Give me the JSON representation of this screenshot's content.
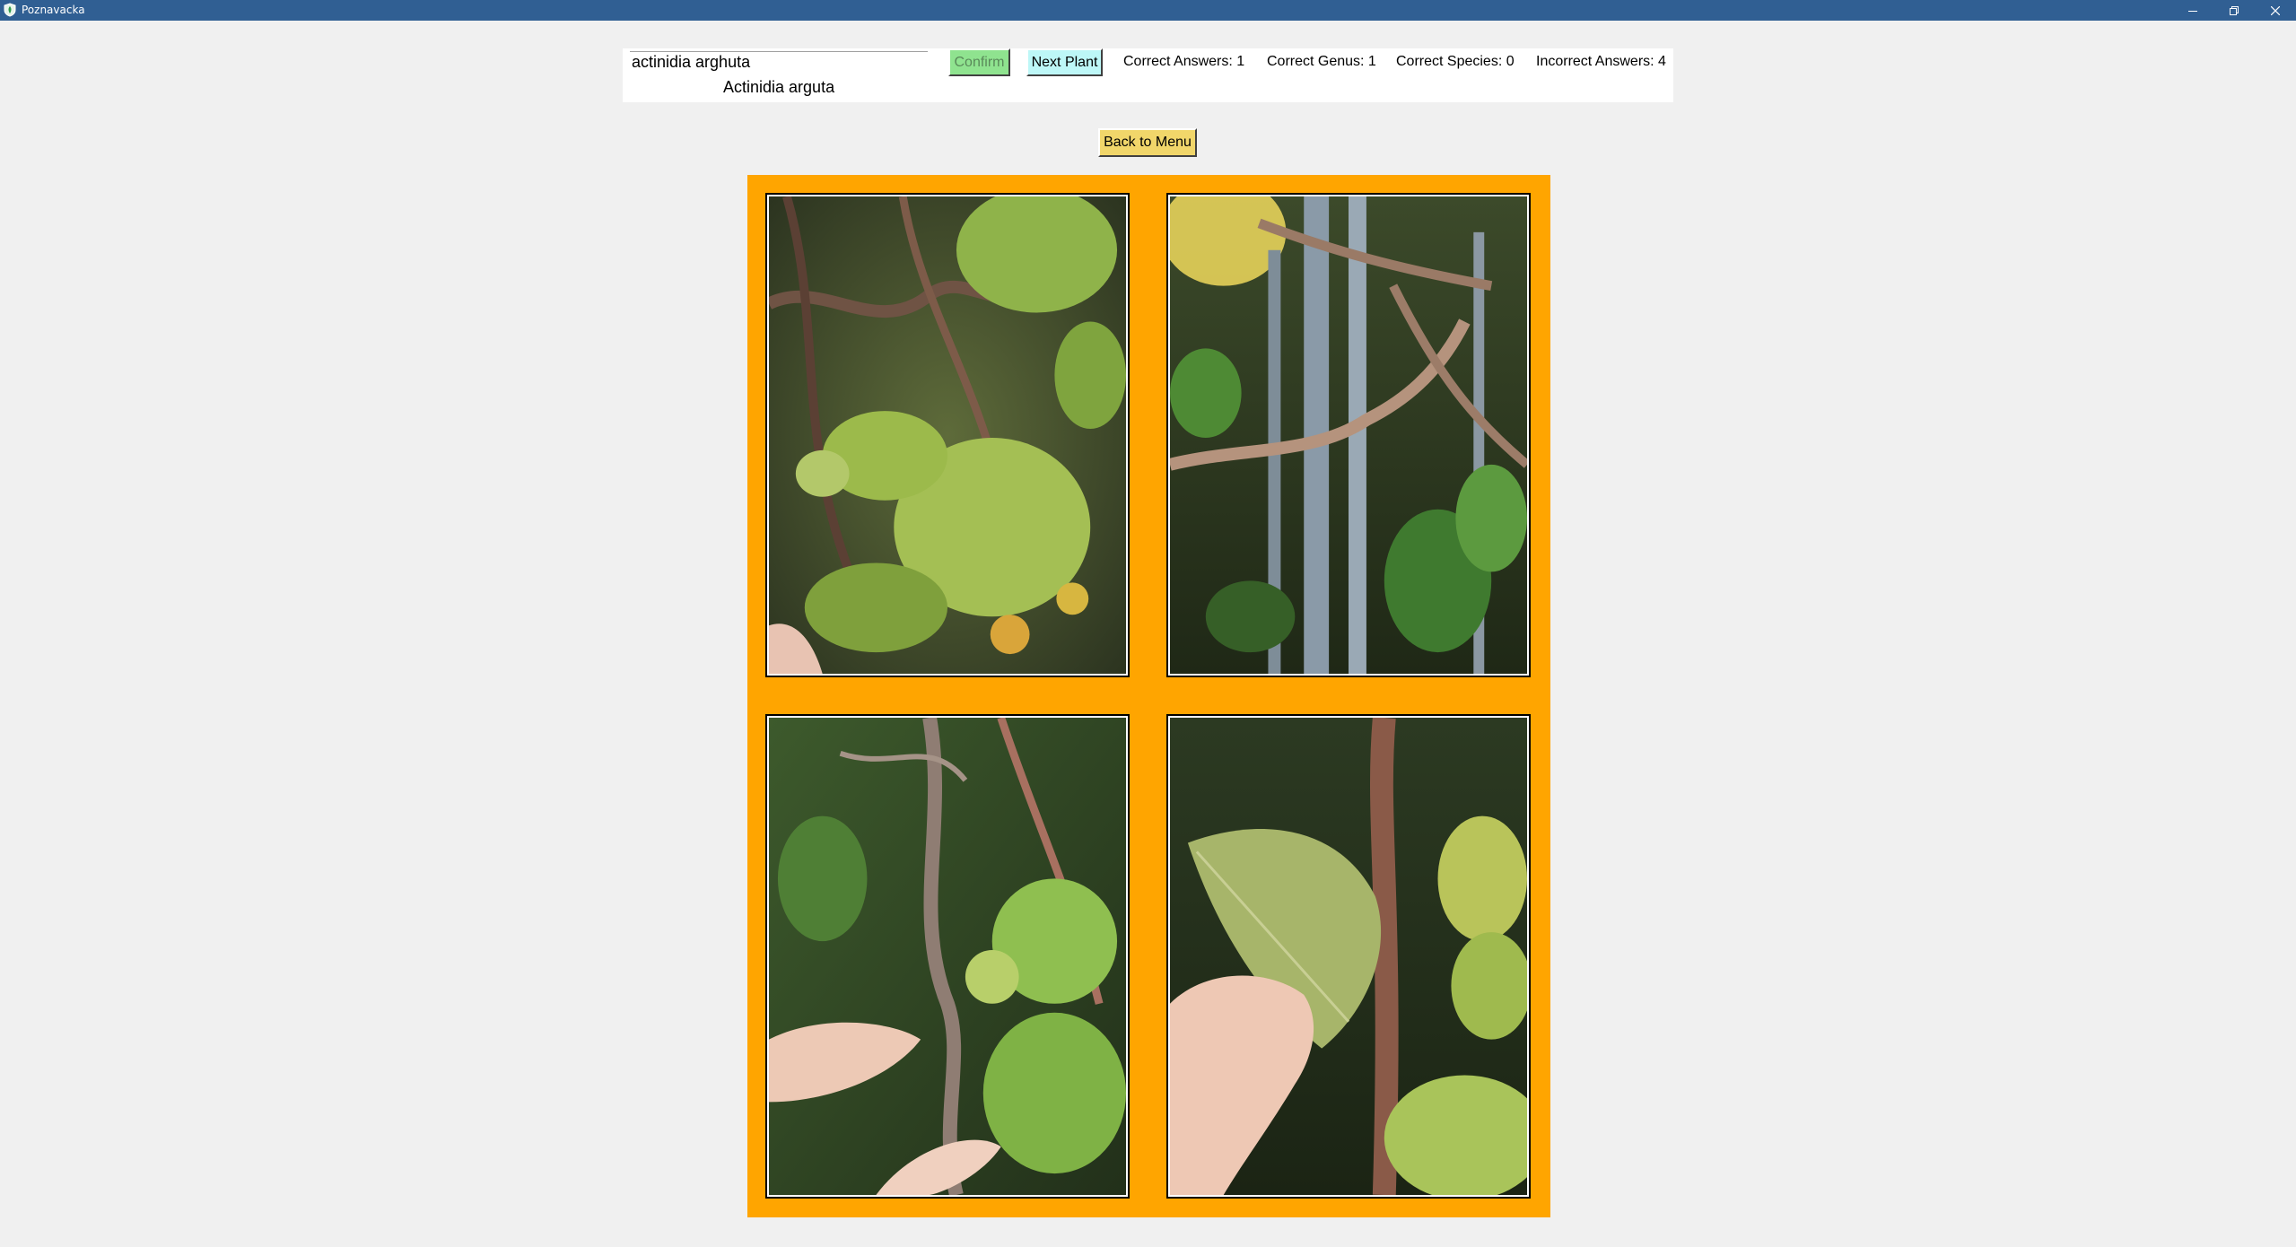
{
  "window": {
    "title": "Poznavacka",
    "icons": [
      "app-shield-icon",
      "minimize-icon",
      "restore-icon",
      "close-icon"
    ]
  },
  "quiz": {
    "answer_value": "actinidia arghuta",
    "suggestion": "Actinidia arguta",
    "confirm_label": "Confirm",
    "next_label": "Next Plant",
    "stats": {
      "correct_answers": "Correct Answers: 1",
      "correct_genus": "Correct Genus: 1",
      "correct_species": "Correct Species: 0",
      "incorrect_answers": "Incorrect Answers: 4"
    },
    "back_label": "Back to Menu"
  },
  "gallery": {
    "frame_color": "#ffa500",
    "photos": [
      "plant photo: kiwi berry fruit with leaves",
      "plant photo: bare branch by fence",
      "plant photo: hand holding small fruit",
      "plant photo: hand holding leaf underside"
    ]
  },
  "colors": {
    "titlebar": "#305f93",
    "confirm_bg": "#8fe38f",
    "next_bg": "#bdf7f7",
    "menu_bg": "#f1d66a"
  }
}
